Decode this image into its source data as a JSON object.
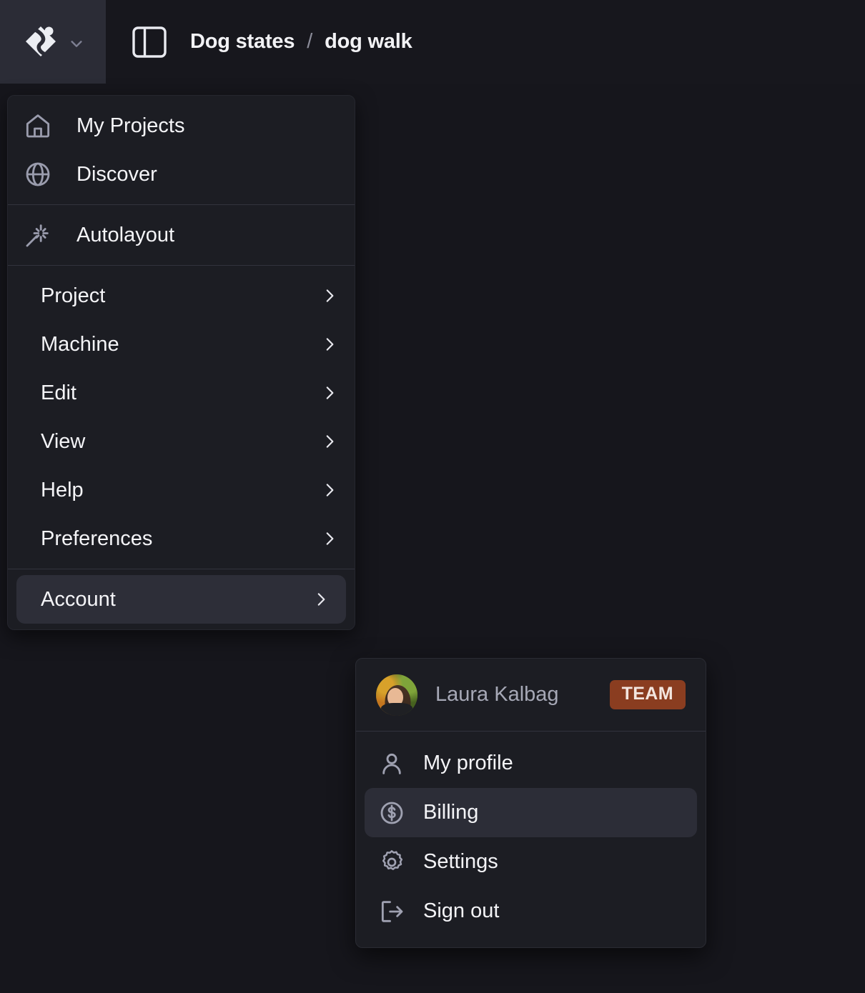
{
  "app": {
    "logo_icon": "stately-logo-icon",
    "logo_chevron_icon": "chevron-down-icon",
    "panel_toggle_icon": "panel-left-icon"
  },
  "breadcrumb": {
    "project": "Dog states",
    "separator": "/",
    "machine": "dog walk"
  },
  "main_menu": {
    "section_nav": [
      {
        "label": "My Projects",
        "icon": "home-icon"
      },
      {
        "label": "Discover",
        "icon": "globe-icon"
      }
    ],
    "section_tools": [
      {
        "label": "Autolayout",
        "icon": "magic-wand-icon"
      }
    ],
    "section_groups": [
      {
        "label": "Project",
        "chevron": "chevron-right-icon"
      },
      {
        "label": "Machine",
        "chevron": "chevron-right-icon"
      },
      {
        "label": "Edit",
        "chevron": "chevron-right-icon"
      },
      {
        "label": "View",
        "chevron": "chevron-right-icon"
      },
      {
        "label": "Help",
        "chevron": "chevron-right-icon"
      },
      {
        "label": "Preferences",
        "chevron": "chevron-right-icon"
      }
    ],
    "section_account": [
      {
        "label": "Account",
        "chevron": "chevron-right-icon",
        "highlighted": true
      }
    ]
  },
  "account_menu": {
    "user": {
      "name": "Laura Kalbag",
      "avatar": "user-avatar",
      "badge": "TEAM"
    },
    "items": [
      {
        "label": "My profile",
        "icon": "person-icon",
        "highlighted": false
      },
      {
        "label": "Billing",
        "icon": "dollar-circle-icon",
        "highlighted": true
      },
      {
        "label": "Settings",
        "icon": "gear-icon",
        "highlighted": false
      },
      {
        "label": "Sign out",
        "icon": "sign-out-icon",
        "highlighted": false
      }
    ]
  },
  "colors": {
    "canvas": "#16161c",
    "topbar": "#17171d",
    "logo_tile": "#2b2c36",
    "menu_panel": "#1c1d23",
    "menu_highlight": "#2d2e38",
    "separator": "#32333d",
    "badge_bg": "#8a3d20",
    "badge_text": "#f3e6df",
    "text_primary": "#f4f4f7",
    "text_muted": "#a6a8b6",
    "icon": "#9a9cad"
  }
}
